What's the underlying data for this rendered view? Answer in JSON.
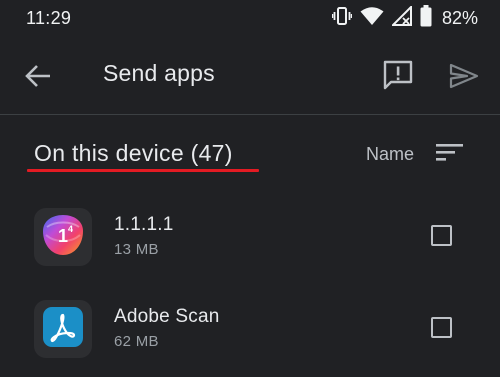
{
  "status_bar": {
    "time": "11:29",
    "battery_percent": "82%",
    "icons": [
      "vibrate-icon",
      "wifi-icon",
      "cellular-no-signal-icon",
      "battery-icon"
    ]
  },
  "app_bar": {
    "title": "Send apps",
    "back_icon": "arrow-back-icon",
    "feedback_icon": "feedback-icon",
    "send_icon": "send-icon"
  },
  "section": {
    "title": "On this device (47)",
    "sort_label": "Name",
    "sort_icon": "sort-icon",
    "underline_color": "#e31b23"
  },
  "apps": [
    {
      "name": "1.1.1.1",
      "size": "13 MB",
      "checked": false,
      "icon": "cloudflare-warp-icon"
    },
    {
      "name": "Adobe Scan",
      "size": "62 MB",
      "checked": false,
      "icon": "adobe-scan-icon"
    }
  ],
  "colors": {
    "background": "#202124",
    "text_primary": "#e8eaed",
    "text_secondary": "#9aa0a6",
    "accent_underline": "#e31b23"
  }
}
